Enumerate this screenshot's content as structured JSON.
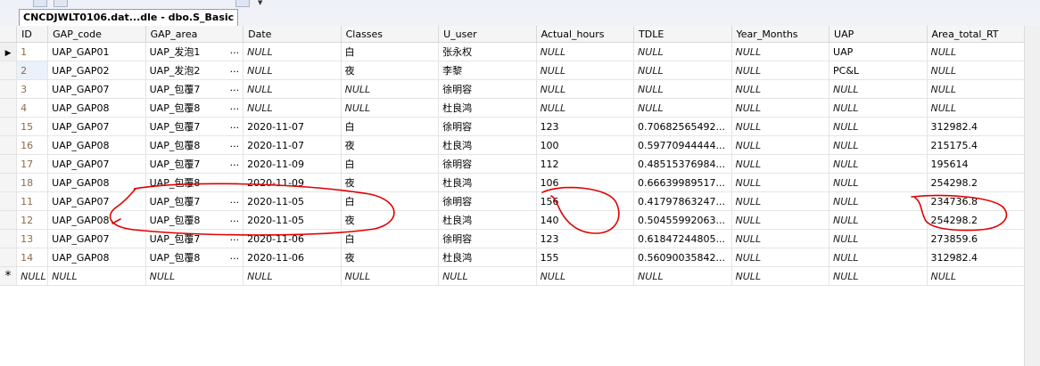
{
  "window": {
    "tab_title": "CNCDJWLT0106.dat...dle - dbo.S_Basic"
  },
  "grid": {
    "columns": [
      "ID",
      "GAP_code",
      "GAP_area",
      "Date",
      "Classes",
      "U_user",
      "Actual_hours",
      "TDLE",
      "Year_Months",
      "UAP",
      "Area_total_RT"
    ],
    "rows": [
      {
        "marker": "▶",
        "cells": [
          "1",
          "UAP_GAP01",
          "UAP_发泡1",
          "NULL",
          "白",
          "张永权",
          "NULL",
          "NULL",
          "NULL",
          "UAP",
          "NULL"
        ]
      },
      {
        "marker": "",
        "cells": [
          "2",
          "UAP_GAP02",
          "UAP_发泡2",
          "NULL",
          "夜",
          "李黎",
          "NULL",
          "NULL",
          "NULL",
          "PC&L",
          "NULL"
        ]
      },
      {
        "marker": "",
        "cells": [
          "3",
          "UAP_GAP07",
          "UAP_包覆7",
          "NULL",
          "NULL",
          "徐明容",
          "NULL",
          "NULL",
          "NULL",
          "NULL",
          "NULL"
        ]
      },
      {
        "marker": "",
        "cells": [
          "4",
          "UAP_GAP08",
          "UAP_包覆8",
          "NULL",
          "NULL",
          "杜良鸿",
          "NULL",
          "NULL",
          "NULL",
          "NULL",
          "NULL"
        ]
      },
      {
        "marker": "",
        "cells": [
          "15",
          "UAP_GAP07",
          "UAP_包覆7",
          "2020-11-07",
          "白",
          "徐明容",
          "123",
          "0.70682565492...",
          "NULL",
          "NULL",
          "312982.4"
        ]
      },
      {
        "marker": "",
        "cells": [
          "16",
          "UAP_GAP08",
          "UAP_包覆8",
          "2020-11-07",
          "夜",
          "杜良鸿",
          "100",
          "0.59770944444...",
          "NULL",
          "NULL",
          "215175.4"
        ]
      },
      {
        "marker": "",
        "cells": [
          "17",
          "UAP_GAP07",
          "UAP_包覆7",
          "2020-11-09",
          "白",
          "徐明容",
          "112",
          "0.48515376984...",
          "NULL",
          "NULL",
          "195614"
        ]
      },
      {
        "marker": "",
        "cells": [
          "18",
          "UAP_GAP08",
          "UAP_包覆8",
          "2020-11-09",
          "夜",
          "杜良鸿",
          "106",
          "0.66639989517...",
          "NULL",
          "NULL",
          "254298.2"
        ]
      },
      {
        "marker": "",
        "cells": [
          "11",
          "UAP_GAP07",
          "UAP_包覆7",
          "2020-11-05",
          "白",
          "徐明容",
          "156",
          "0.41797863247...",
          "NULL",
          "NULL",
          "234736.8"
        ]
      },
      {
        "marker": "",
        "cells": [
          "12",
          "UAP_GAP08",
          "UAP_包覆8",
          "2020-11-05",
          "夜",
          "杜良鸿",
          "140",
          "0.50455992063...",
          "NULL",
          "NULL",
          "254298.2"
        ]
      },
      {
        "marker": "",
        "cells": [
          "13",
          "UAP_GAP07",
          "UAP_包覆7",
          "2020-11-06",
          "白",
          "徐明容",
          "123",
          "0.61847244805...",
          "NULL",
          "NULL",
          "273859.6"
        ]
      },
      {
        "marker": "",
        "cells": [
          "14",
          "UAP_GAP08",
          "UAP_包覆8",
          "2020-11-06",
          "夜",
          "杜良鸿",
          "155",
          "0.56090035842...",
          "NULL",
          "NULL",
          "312982.4"
        ]
      },
      {
        "marker": "*",
        "cells": [
          "NULL",
          "NULL",
          "NULL",
          "NULL",
          "NULL",
          "NULL",
          "NULL",
          "NULL",
          "NULL",
          "NULL",
          "NULL"
        ]
      }
    ],
    "null_text": "NULL",
    "truncation_marker": "...",
    "truncated_columns": [
      "GAP_area"
    ]
  },
  "annotation": {
    "color": "#e00000"
  }
}
